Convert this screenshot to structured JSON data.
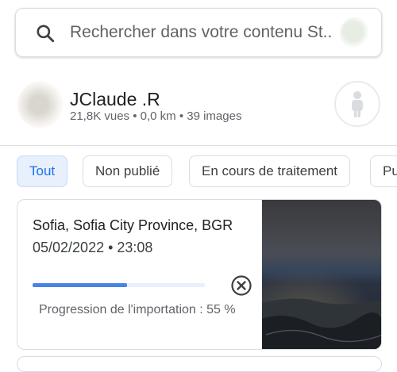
{
  "search": {
    "placeholder": "Rechercher dans votre contenu St...",
    "icon": "search-icon",
    "avatar_icon": "account-avatar"
  },
  "profile": {
    "name": "JClaude .R",
    "stats": "21,8K vues • 0,0 km • 39 images",
    "person_icon": "person-icon"
  },
  "filters": [
    {
      "label": "Tout",
      "selected": true
    },
    {
      "label": "Non publié",
      "selected": false
    },
    {
      "label": "En cours de traitement",
      "selected": false
    },
    {
      "label": "Pu",
      "selected": false
    }
  ],
  "upload_card": {
    "location": "Sofia, Sofia City Province, BGR",
    "datetime": "05/02/2022 • 23:08",
    "progress_fraction": 0.55,
    "progress_label": "Progression de l'importation : 55 %",
    "cancel_icon": "cancel-circle-icon",
    "thumbnail": "night city panorama photo"
  },
  "colors": {
    "accent": "#1a73e8",
    "progress": "#4a82e6",
    "active_chip_bg": "#e8f0fe"
  }
}
